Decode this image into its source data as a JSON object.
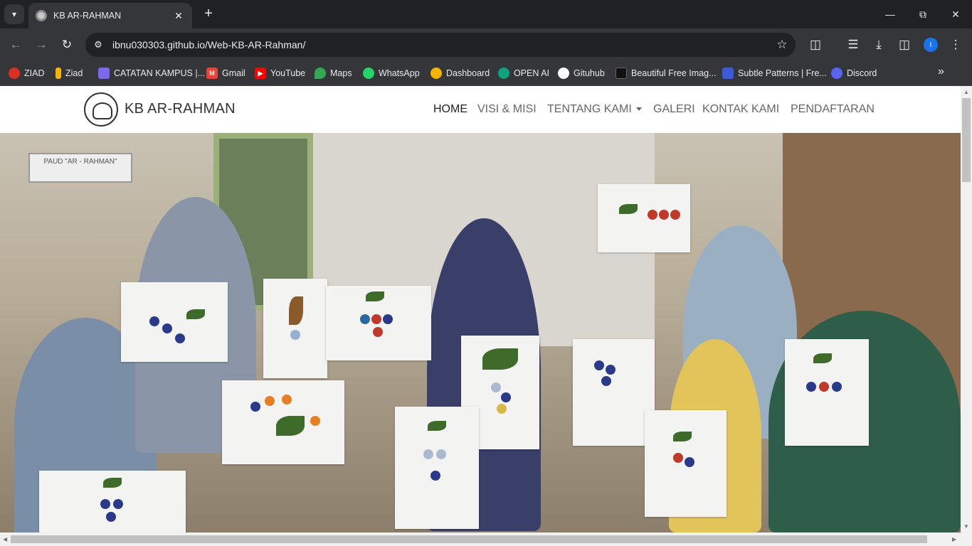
{
  "browser": {
    "tab_title": "KB AR-RAHMAN",
    "url": "ibnu030303.github.io/Web-KB-AR-Rahman/",
    "profile_initial": "I",
    "bookmarks": [
      {
        "label": "ZIAD",
        "color": "#d93025"
      },
      {
        "label": "Ziad",
        "color": "#f4b400"
      },
      {
        "label": "CATATAN KAMPUS |...",
        "color": "#7b68ee"
      },
      {
        "label": "Gmail",
        "color": "#ea4335"
      },
      {
        "label": "YouTube",
        "color": "#ff0000"
      },
      {
        "label": "Maps",
        "color": "#34a853"
      },
      {
        "label": "WhatsApp",
        "color": "#25d366"
      },
      {
        "label": "Dashboard",
        "color": "#f4b400"
      },
      {
        "label": "OPEN AI",
        "color": "#10a37f"
      },
      {
        "label": "Gituhub",
        "color": "#ffffff"
      },
      {
        "label": "Beautiful Free Imag...",
        "color": "#111111"
      },
      {
        "label": "Subtle Patterns | Fre...",
        "color": "#3b5bdb"
      },
      {
        "label": "Discord",
        "color": "#5865f2"
      }
    ]
  },
  "site": {
    "brand": "KB AR-RAHMAN",
    "nav": {
      "home": "HOME",
      "visi_misi": "VISI & MISI",
      "tentang_kami": "TENTANG KAMI",
      "galeri": "GALERI",
      "kontak_kami": "KONTAK KAMI",
      "pendaftaran": "PENDAFTARAN"
    },
    "hero_sign": "PAUD \"AR - RAHMAN\""
  }
}
